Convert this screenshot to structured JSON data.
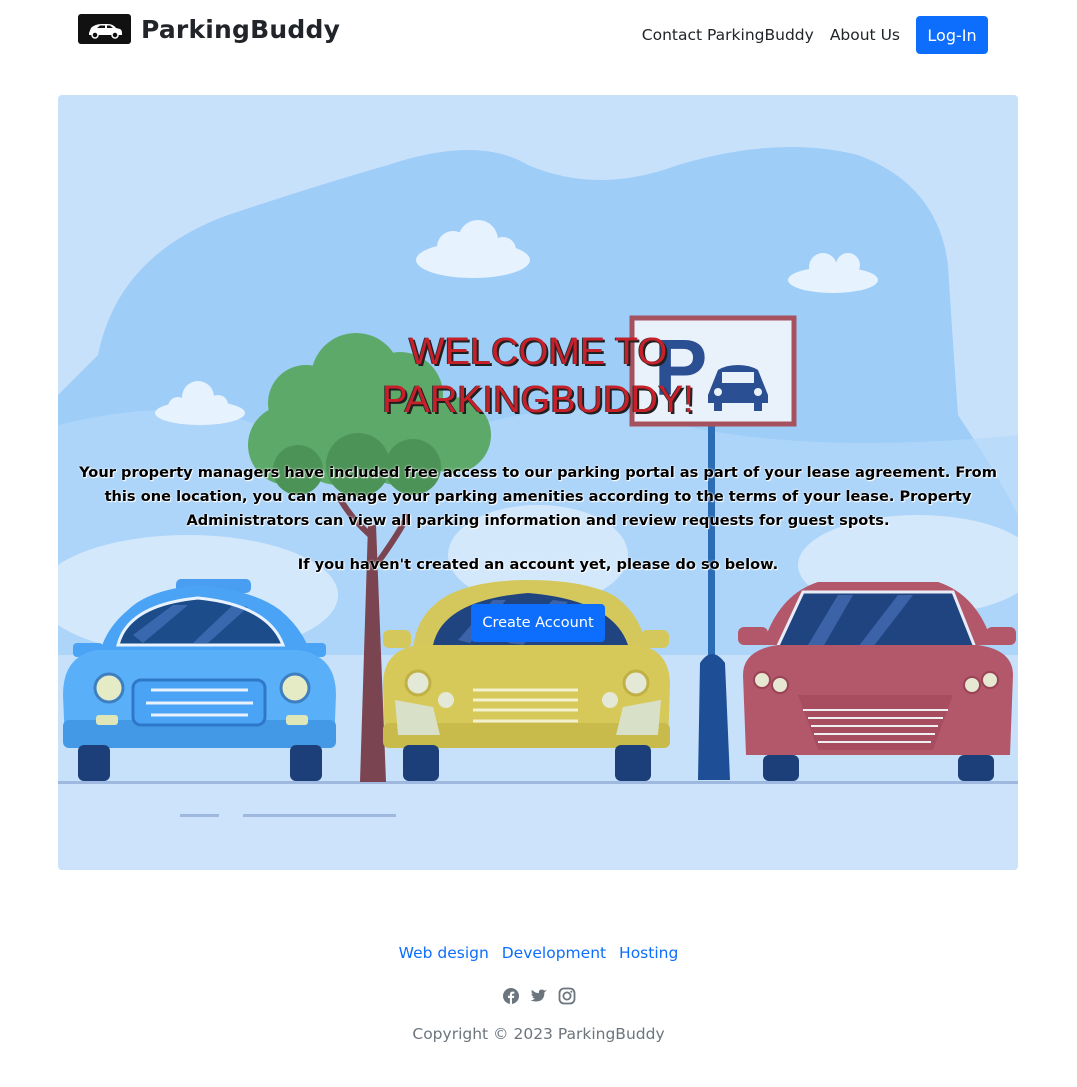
{
  "nav": {
    "brand": "ParkingBuddy",
    "links": [
      "Contact ParkingBuddy",
      "About Us"
    ],
    "login_label": "Log-In"
  },
  "hero": {
    "title_line1": "WELCOME TO",
    "title_line2": "PARKINGBUDDY!",
    "description": "Your property managers have included free access to our parking portal as part of your lease agreement. From this one location, you can manage your parking amenities according to the terms of your lease. Property Administrators can view all parking information and review requests for guest spots.",
    "subtext": "If you haven't created an account yet, please do so below.",
    "create_account_label": "Create Account"
  },
  "footer": {
    "links": [
      "Web design",
      "Development",
      "Hosting"
    ],
    "social_icons": [
      "facebook-icon",
      "twitter-icon",
      "instagram-icon"
    ],
    "copyright": "Copyright © 2023 ParkingBuddy"
  },
  "colors": {
    "primary": "#0d6efd",
    "hero_bg": "#c8e1fb",
    "title_red": "#c8202a"
  }
}
